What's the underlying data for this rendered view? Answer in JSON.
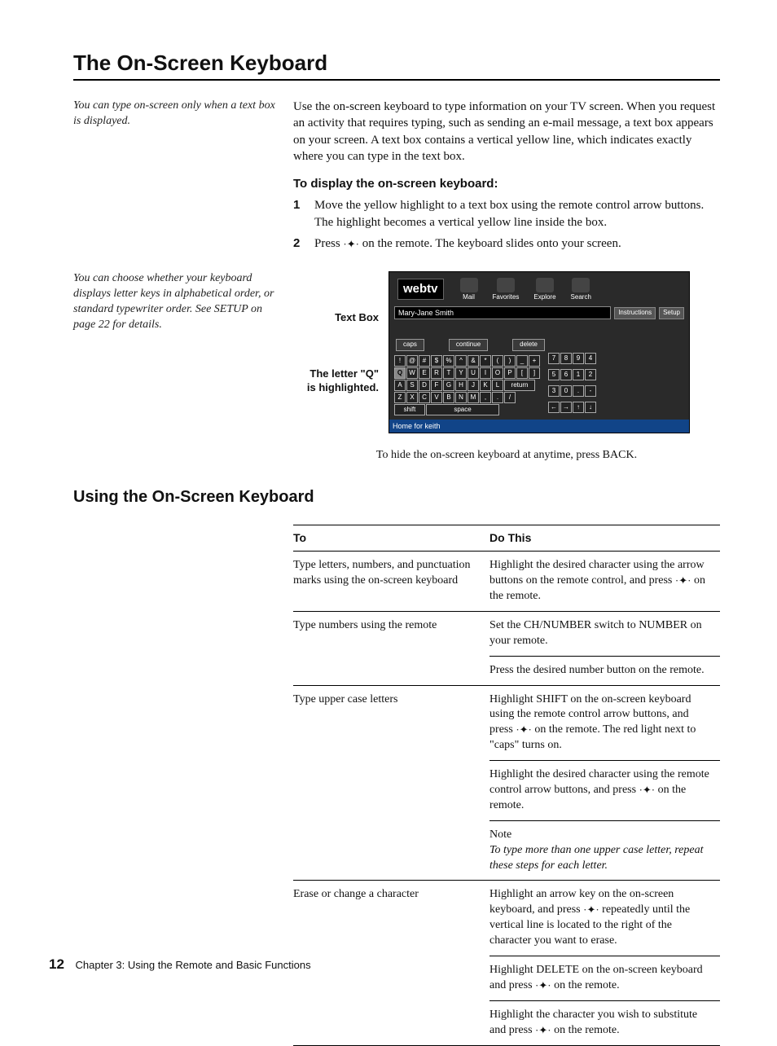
{
  "page_title": "The On-Screen Keyboard",
  "sidenote_top": "You can type on-screen only when a text box is displayed.",
  "intro_paragraph": "Use the on-screen keyboard to type information on your TV screen. When you request an activity that requires typing, such as sending an e-mail message, a text box appears on your screen. A text box contains a vertical yellow line, which indicates exactly where you can type in the text box.",
  "how_to_heading": "To display the on-screen keyboard:",
  "steps": [
    {
      "num": "1",
      "text": "Move the yellow highlight to a text box using the remote control arrow buttons. The highlight becomes a vertical yellow line inside the box."
    },
    {
      "num": "2",
      "pre": "Press ",
      "post": " on the remote. The keyboard slides onto your screen."
    }
  ],
  "sidenote_mid": "You can choose whether your keyboard displays letter keys in alphabetical order, or standard typewriter order. See SETUP on page 22 for details.",
  "figure": {
    "label_textbox": "Text Box",
    "label_q_l1": "The letter \"Q\"",
    "label_q_l2": "is highlighted.",
    "logo": "webtv",
    "nav": [
      "Mail",
      "Favorites",
      "Explore",
      "Search"
    ],
    "field_value": "Mary-Jane Smith",
    "right_pills": [
      "Instructions",
      "Setup"
    ],
    "kbd_top": {
      "caps": "caps",
      "continue": "continue",
      "delete": "delete"
    },
    "rows": {
      "r1": [
        "!",
        "@",
        "#",
        "$",
        "%",
        "^",
        "&",
        "*",
        "(",
        ")",
        "_",
        "+"
      ],
      "r2": [
        "Q",
        "W",
        "E",
        "R",
        "T",
        "Y",
        "U",
        "I",
        "O",
        "P",
        "[",
        "]"
      ],
      "r3": [
        "A",
        "S",
        "D",
        "F",
        "G",
        "H",
        "J",
        "K",
        "L"
      ],
      "r4": [
        "Z",
        "X",
        "C",
        "V",
        "B",
        "N",
        "M",
        ",",
        ".",
        "/"
      ],
      "shift": "shift",
      "space": "space",
      "return": "return"
    },
    "numpad": [
      "7",
      "8",
      "9",
      "4",
      "5",
      "6",
      "1",
      "2",
      "3",
      "0",
      ".",
      "-",
      "←",
      "→",
      "↑",
      "↓"
    ],
    "status": "Home for keith"
  },
  "caption_hide": "To hide the on-screen keyboard at anytime, press BACK.",
  "section_heading": "Using the On-Screen Keyboard",
  "table": {
    "headers": [
      "To",
      "Do This"
    ],
    "groups": [
      {
        "to": "Type letters, numbers, and punctuation marks using the on-screen keyboard",
        "steps": [
          {
            "pre": "Highlight the desired character using the arrow buttons on the remote control, and press ",
            "post": " on the remote."
          }
        ]
      },
      {
        "to": "Type numbers using the remote",
        "steps": [
          {
            "plain": "Set the CH/NUMBER switch to NUMBER on your remote."
          },
          {
            "plain": "Press the desired number button on the remote."
          }
        ]
      },
      {
        "to": "Type upper case letters",
        "steps": [
          {
            "pre": "Highlight SHIFT on the on-screen keyboard using the remote control arrow buttons, and press ",
            "post": " on the remote. The red light next to \"caps\" turns on."
          },
          {
            "pre": "Highlight the desired character using the remote control arrow buttons, and press ",
            "post": " on the remote."
          },
          {
            "note_label": "Note",
            "note_text": "To type more than one upper case letter, repeat these steps for each letter."
          }
        ]
      },
      {
        "to": "Erase or change a character",
        "steps": [
          {
            "pre": "Highlight an arrow key on the on-screen keyboard, and press ",
            "post": " repeatedly until the vertical line is located to the right of the character you want to erase."
          },
          {
            "pre": "Highlight DELETE on the on-screen keyboard and press ",
            "post": " on the remote."
          },
          {
            "pre": "Highlight the character you wish to substitute and press ",
            "post": " on the remote."
          }
        ]
      }
    ]
  },
  "go_glyph": "·✦·",
  "footer": {
    "page": "12",
    "chapter": "Chapter 3: Using the Remote and Basic Functions"
  }
}
